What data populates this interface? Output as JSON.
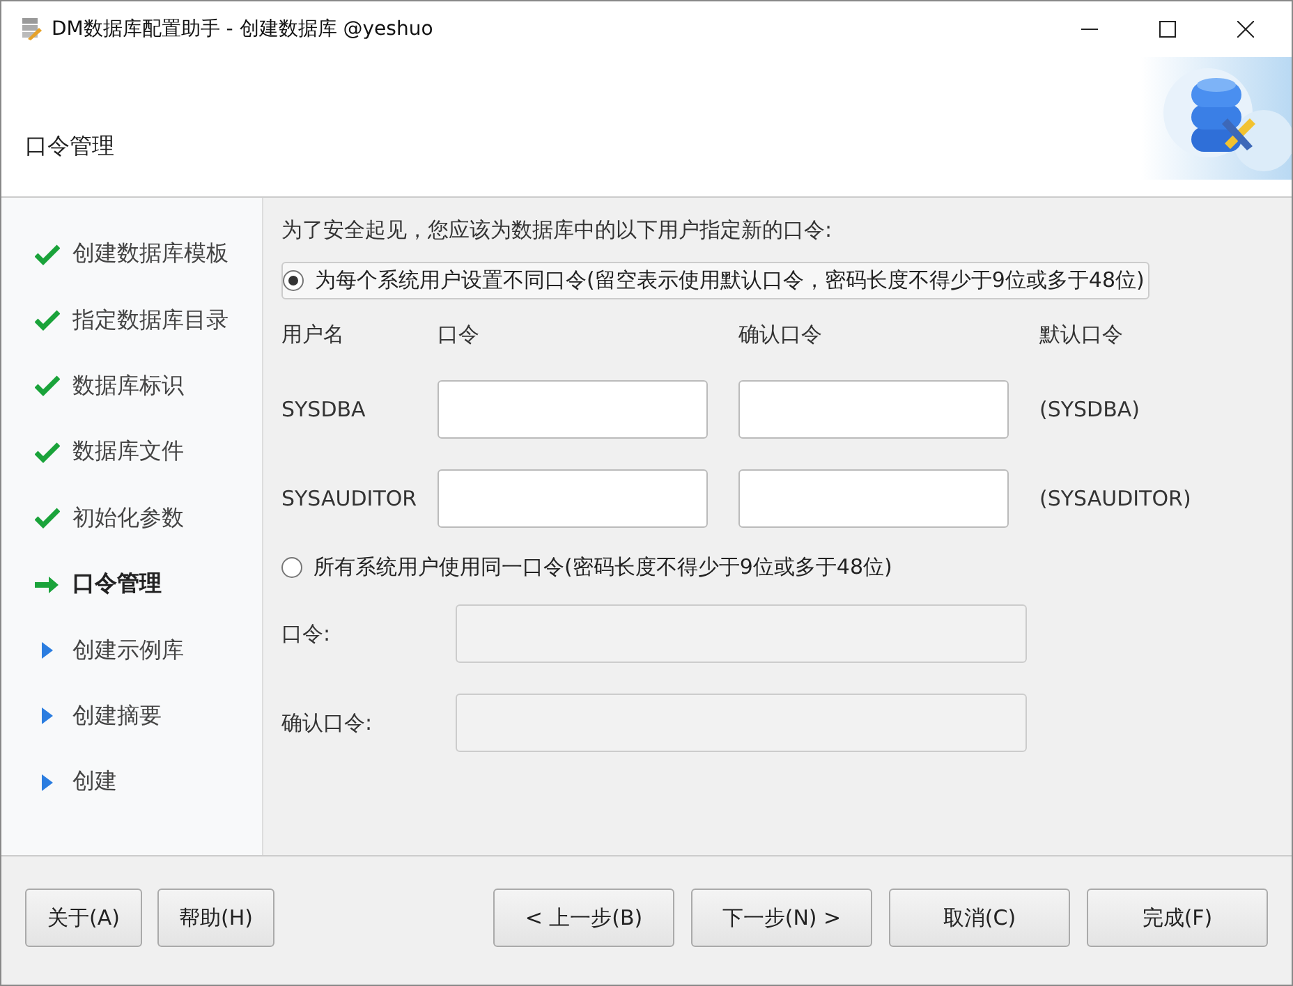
{
  "window": {
    "title": "DM数据库配置助手 - 创建数据库 @yeshuo"
  },
  "header": {
    "title": "口令管理",
    "kind": "picture"
  },
  "steps": [
    {
      "label": "创建数据库模板",
      "kind": "done"
    },
    {
      "label": "指定数据库目录",
      "kind": "done"
    },
    {
      "label": "数据库标识",
      "kind": "done"
    },
    {
      "label": "数据库文件",
      "kind": "done"
    },
    {
      "label": "初始化参数",
      "kind": "done"
    },
    {
      "label": "口令管理",
      "kind": "current"
    },
    {
      "label": "创建示例库",
      "kind": "pending"
    },
    {
      "label": "创建摘要",
      "kind": "pending"
    },
    {
      "label": "创建",
      "kind": "pending"
    }
  ],
  "intro": "为了安全起见，您应该为数据库中的以下用户指定新的口令:",
  "option_separate": {
    "label": "为每个系统用户设置不同口令(留空表示使用默认口令，密码长度不得少于9位或多于48位)",
    "selected": true
  },
  "table": {
    "columns": [
      "用户名",
      "口令",
      "确认口令",
      "默认口令"
    ],
    "rows": [
      {
        "user": "SYSDBA",
        "default": "(SYSDBA)"
      },
      {
        "user": "SYSAUDITOR",
        "default": "(SYSAUDITOR)"
      }
    ]
  },
  "option_same": {
    "label": "所有系统用户使用同一口令(密码长度不得少于9位或多于48位)",
    "selected": false
  },
  "same_fields": [
    {
      "label": "口令:",
      "disabled": true
    },
    {
      "label": "确认口令:",
      "disabled": true
    }
  ],
  "buttons_left": [
    "关于(A)",
    "帮助(H)"
  ],
  "buttons_right": [
    "< 上一步(B)",
    "下一步(N) >",
    "取消(C)",
    "完成(F)"
  ]
}
